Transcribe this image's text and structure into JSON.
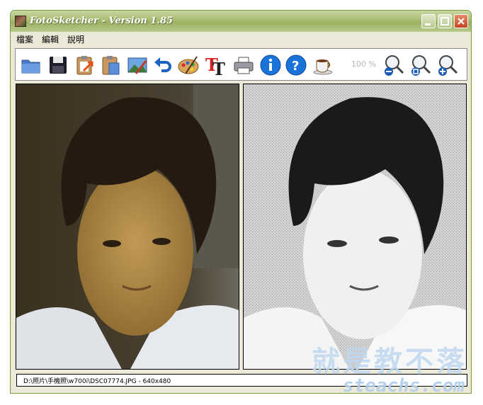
{
  "window": {
    "title": "FotoSketcher - Version 1.85"
  },
  "menu": {
    "items": [
      {
        "label": "檔案"
      },
      {
        "label": "編輯"
      },
      {
        "label": "說明"
      }
    ]
  },
  "toolbar": {
    "zoom_label": "100 %",
    "icons": [
      "open-folder-icon",
      "save-disk-icon",
      "export-clipboard-icon",
      "paste-clipboard-icon",
      "edit-picture-icon",
      "undo-arrow-icon",
      "palette-icon",
      "text-tool-icon",
      "print-icon",
      "info-icon",
      "help-icon",
      "coffee-cup-icon",
      "zoom-out-icon",
      "zoom-fit-icon",
      "zoom-in-icon"
    ]
  },
  "status": {
    "text": "D:\\照片\\手機照\\w700i\\DSC07774.JPG - 640x480"
  },
  "watermark": {
    "chinese": "就是教不落",
    "url": "steachs.com"
  },
  "colors": {
    "title_bar": "#a9bc72",
    "info_blue": "#1a73d9",
    "window_bg": "#ece9d8"
  }
}
